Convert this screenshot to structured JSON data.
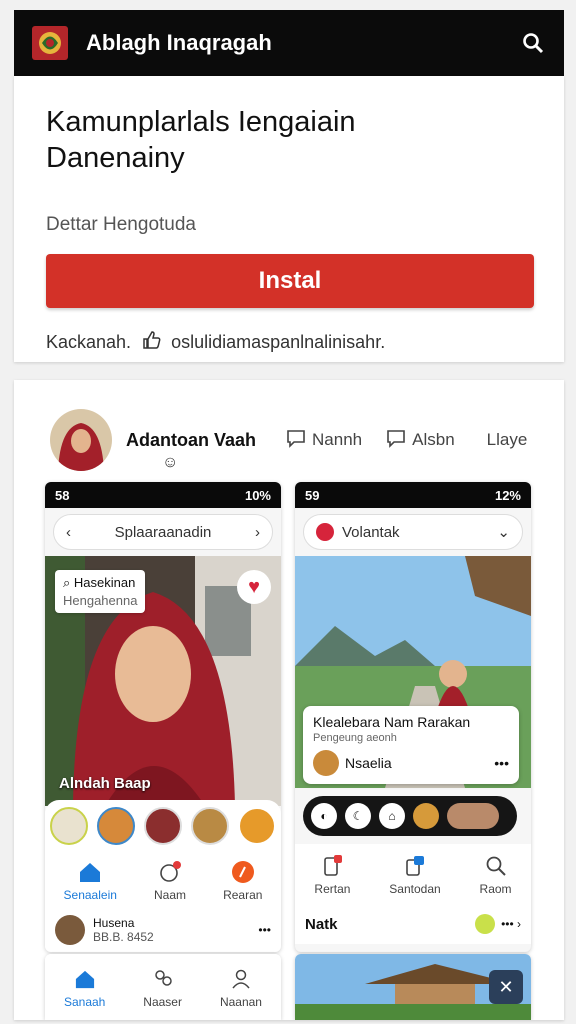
{
  "topbar": {
    "title": "Ablagh Inaqragah"
  },
  "app": {
    "title_line1": "Kamunplarlals Iengaiain",
    "title_line2": "Danenainy",
    "subtitle": "Dettar Hengotuda",
    "install_label": "Instal",
    "meta_left": "Kackanah.",
    "meta_right": "oslulidiamaspanlnalinisahr."
  },
  "profile": {
    "name": "Adantoan Vaah",
    "actions": [
      "Nannh",
      "Alsbn",
      "Llaye"
    ]
  },
  "phone1": {
    "status_left": "58",
    "status_right": "10%",
    "nav_title": "Splaaraanadin",
    "chip_title": "Hasekinan",
    "chip_sub": "Hengahenna",
    "caption": "Alndah Baap",
    "tabs": [
      "Senaalein",
      "Naam",
      "Rearan"
    ],
    "footer_line1": "Husena",
    "footer_line2": "BB.B. 8452"
  },
  "phone2": {
    "status_left": "59",
    "status_right": "12%",
    "nav_title": "Volantak",
    "card_title": "Klealebara Nam Rarakan",
    "card_sub": "Pengeung aeonh",
    "card_user": "Nsaelia",
    "tabs": [
      "Rertan",
      "Santodan",
      "Raom"
    ],
    "footer_label": "Natk"
  },
  "bottom1": {
    "tabs": [
      "Sanaah",
      "Naaser",
      "Naanan"
    ]
  },
  "colors": {
    "accent_red": "#d33128",
    "dark": "#0b0b0b",
    "tab_blue": "#1b7ad8"
  }
}
